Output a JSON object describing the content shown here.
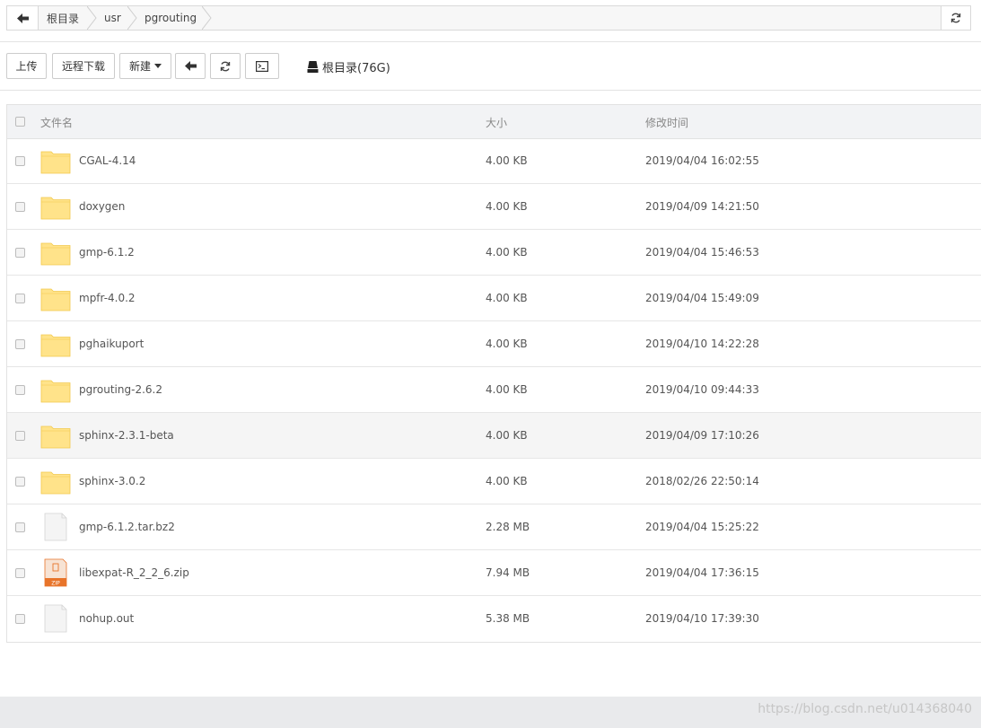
{
  "breadcrumb": {
    "items": [
      "根目录",
      "usr",
      "pgrouting"
    ]
  },
  "toolbar": {
    "upload_label": "上传",
    "remote_download_label": "远程下载",
    "new_label": "新建",
    "disk_label": "根目录(76G)"
  },
  "table": {
    "headers": {
      "name": "文件名",
      "size": "大小",
      "modified": "修改时间"
    },
    "rows": [
      {
        "name": "CGAL-4.14",
        "size": "4.00 KB",
        "modified": "2019/04/04 16:02:55",
        "type": "folder"
      },
      {
        "name": "doxygen",
        "size": "4.00 KB",
        "modified": "2019/04/09 14:21:50",
        "type": "folder"
      },
      {
        "name": "gmp-6.1.2",
        "size": "4.00 KB",
        "modified": "2019/04/04 15:46:53",
        "type": "folder"
      },
      {
        "name": "mpfr-4.0.2",
        "size": "4.00 KB",
        "modified": "2019/04/04 15:49:09",
        "type": "folder"
      },
      {
        "name": "pghaikuport",
        "size": "4.00 KB",
        "modified": "2019/04/10 14:22:28",
        "type": "folder"
      },
      {
        "name": "pgrouting-2.6.2",
        "size": "4.00 KB",
        "modified": "2019/04/10 09:44:33",
        "type": "folder"
      },
      {
        "name": "sphinx-2.3.1-beta",
        "size": "4.00 KB",
        "modified": "2019/04/09 17:10:26",
        "type": "folder"
      },
      {
        "name": "sphinx-3.0.2",
        "size": "4.00 KB",
        "modified": "2018/02/26 22:50:14",
        "type": "folder"
      },
      {
        "name": "gmp-6.1.2.tar.bz2",
        "size": "2.28 MB",
        "modified": "2019/04/04 15:25:22",
        "type": "file"
      },
      {
        "name": "libexpat-R_2_2_6.zip",
        "size": "7.94 MB",
        "modified": "2019/04/04 17:36:15",
        "type": "zip"
      },
      {
        "name": "nohup.out",
        "size": "5.38 MB",
        "modified": "2019/04/10 17:39:30",
        "type": "file"
      }
    ]
  },
  "zip_badge": "ZIP",
  "watermark": "https://blog.csdn.net/u014368040",
  "colors": {
    "folder": "#ffe38a",
    "folder_edge": "#f2c94c",
    "zip": "#e8742a"
  }
}
